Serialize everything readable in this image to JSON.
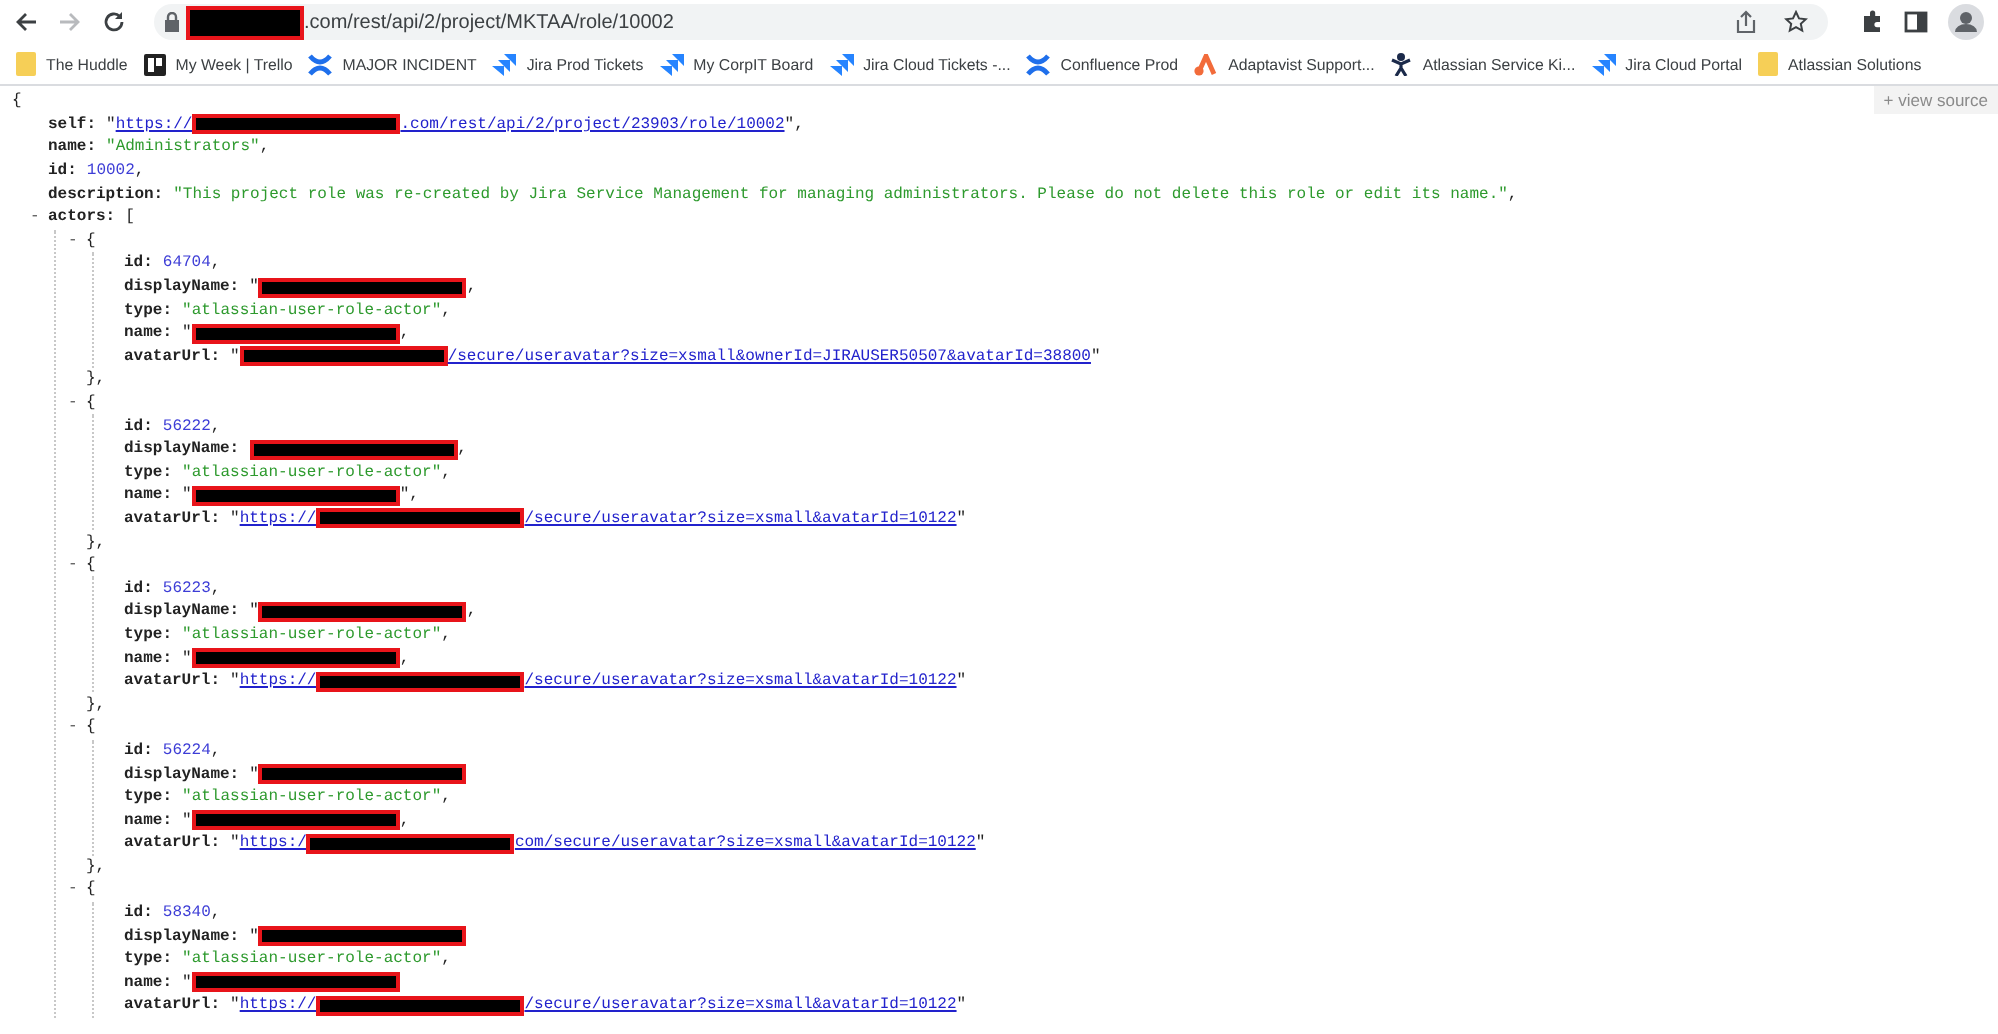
{
  "browser": {
    "back": {
      "disabled": false
    },
    "forward": {
      "disabled": true
    },
    "address": [
      {
        "kind": "redacted"
      },
      {
        "kind": "text",
        "text": ".com/rest/api/2/project/MKTAA/role/10002"
      }
    ],
    "bookmarks": [
      {
        "label": "The Huddle",
        "kind": "folder"
      },
      {
        "label": "My Week | Trello",
        "kind": "board"
      },
      {
        "label": "MAJOR INCIDENT",
        "kind": "cross"
      },
      {
        "label": "Jira Prod Tickets",
        "kind": "arrows"
      },
      {
        "label": "My CorpIT Board",
        "kind": "arrows"
      },
      {
        "label": "Jira Cloud Tickets -...",
        "kind": "arrows"
      },
      {
        "label": "Confluence Prod",
        "kind": "cross"
      },
      {
        "label": "Adaptavist Support...",
        "kind": "nodes"
      },
      {
        "label": "Atlassian Service Ki...",
        "kind": "figure"
      },
      {
        "label": "Jira Cloud Portal",
        "kind": "arrows"
      },
      {
        "label": "Atlassian Solutions",
        "kind": "folder"
      }
    ]
  },
  "view_source": "+ view source",
  "document": {
    "open": "{",
    "children": [
      {
        "key": "self:",
        "value": [
          {
            "kind": "punct",
            "text": "\""
          },
          {
            "kind": "link",
            "text": "https://"
          },
          {
            "kind": "redacted"
          },
          {
            "kind": "link",
            "text": ".com/rest/api/2/project/23903/role/10002"
          },
          {
            "kind": "punct",
            "text": "\","
          }
        ]
      },
      {
        "key": "name:",
        "value": [
          {
            "kind": "string",
            "text": "\"Administrators\""
          },
          {
            "kind": "punct",
            "text": ","
          }
        ]
      },
      {
        "key": "id:",
        "value": [
          {
            "kind": "number",
            "text": "10002"
          },
          {
            "kind": "punct",
            "text": ","
          }
        ]
      },
      {
        "key": "description:",
        "value": [
          {
            "kind": "string",
            "text": "\"This project role was re-created by Jira Service Management for managing administrators. Please do not delete this role or edit its name.\""
          },
          {
            "kind": "punct",
            "text": ","
          }
        ]
      },
      {
        "key": "actors:",
        "toggle": "-",
        "open": "[",
        "children": [
          {
            "toggle": "-",
            "open": "{",
            "close": "},",
            "children": [
              {
                "key": "id:",
                "value": [
                  {
                    "kind": "number",
                    "text": "64704"
                  },
                  {
                    "kind": "punct",
                    "text": ","
                  }
                ]
              },
              {
                "key": "displayName:",
                "value": [
                  {
                    "kind": "punct",
                    "text": "\""
                  },
                  {
                    "kind": "redacted"
                  },
                  {
                    "kind": "punct",
                    "text": ","
                  }
                ]
              },
              {
                "key": "type:",
                "value": [
                  {
                    "kind": "string",
                    "text": "\"atlassian-user-role-actor\""
                  },
                  {
                    "kind": "punct",
                    "text": ","
                  }
                ]
              },
              {
                "key": "name:",
                "value": [
                  {
                    "kind": "punct",
                    "text": "\""
                  },
                  {
                    "kind": "redacted"
                  },
                  {
                    "kind": "punct",
                    "text": ","
                  }
                ]
              },
              {
                "key": "avatarUrl:",
                "value": [
                  {
                    "kind": "punct",
                    "text": "\""
                  },
                  {
                    "kind": "redacted"
                  },
                  {
                    "kind": "link",
                    "text": "/secure/useravatar?size=xsmall&ownerId=JIRAUSER50507&avatarId=38800"
                  },
                  {
                    "kind": "punct",
                    "text": "\""
                  }
                ]
              }
            ]
          },
          {
            "toggle": "-",
            "open": "{",
            "close": "},",
            "children": [
              {
                "key": "id:",
                "value": [
                  {
                    "kind": "number",
                    "text": "56222"
                  },
                  {
                    "kind": "punct",
                    "text": ","
                  }
                ]
              },
              {
                "key": "displayName:",
                "value": [
                  {
                    "kind": "redacted"
                  },
                  {
                    "kind": "punct",
                    "text": ","
                  }
                ]
              },
              {
                "key": "type:",
                "value": [
                  {
                    "kind": "string",
                    "text": "\"atlassian-user-role-actor\""
                  },
                  {
                    "kind": "punct",
                    "text": ","
                  }
                ]
              },
              {
                "key": "name:",
                "value": [
                  {
                    "kind": "punct",
                    "text": "\""
                  },
                  {
                    "kind": "redacted"
                  },
                  {
                    "kind": "punct",
                    "text": "\","
                  }
                ]
              },
              {
                "key": "avatarUrl:",
                "value": [
                  {
                    "kind": "punct",
                    "text": "\""
                  },
                  {
                    "kind": "link",
                    "text": "https://"
                  },
                  {
                    "kind": "redacted"
                  },
                  {
                    "kind": "link",
                    "text": "/secure/useravatar?size=xsmall&avatarId=10122"
                  },
                  {
                    "kind": "punct",
                    "text": "\""
                  }
                ]
              }
            ]
          },
          {
            "toggle": "-",
            "open": "{",
            "close": "},",
            "children": [
              {
                "key": "id:",
                "value": [
                  {
                    "kind": "number",
                    "text": "56223"
                  },
                  {
                    "kind": "punct",
                    "text": ","
                  }
                ]
              },
              {
                "key": "displayName:",
                "value": [
                  {
                    "kind": "punct",
                    "text": "\""
                  },
                  {
                    "kind": "redacted"
                  },
                  {
                    "kind": "punct",
                    "text": ","
                  }
                ]
              },
              {
                "key": "type:",
                "value": [
                  {
                    "kind": "string",
                    "text": "\"atlassian-user-role-actor\""
                  },
                  {
                    "kind": "punct",
                    "text": ","
                  }
                ]
              },
              {
                "key": "name:",
                "value": [
                  {
                    "kind": "punct",
                    "text": "\""
                  },
                  {
                    "kind": "redacted"
                  },
                  {
                    "kind": "punct",
                    "text": ","
                  }
                ]
              },
              {
                "key": "avatarUrl:",
                "value": [
                  {
                    "kind": "punct",
                    "text": "\""
                  },
                  {
                    "kind": "link",
                    "text": "https://"
                  },
                  {
                    "kind": "redacted"
                  },
                  {
                    "kind": "link",
                    "text": "/secure/useravatar?size=xsmall&avatarId=10122"
                  },
                  {
                    "kind": "punct",
                    "text": "\""
                  }
                ]
              }
            ]
          },
          {
            "toggle": "-",
            "open": "{",
            "close": "},",
            "children": [
              {
                "key": "id:",
                "value": [
                  {
                    "kind": "number",
                    "text": "56224"
                  },
                  {
                    "kind": "punct",
                    "text": ","
                  }
                ]
              },
              {
                "key": "displayName:",
                "value": [
                  {
                    "kind": "punct",
                    "text": "\""
                  },
                  {
                    "kind": "redacted"
                  }
                ]
              },
              {
                "key": "type:",
                "value": [
                  {
                    "kind": "string",
                    "text": "\"atlassian-user-role-actor\""
                  },
                  {
                    "kind": "punct",
                    "text": ","
                  }
                ]
              },
              {
                "key": "name:",
                "value": [
                  {
                    "kind": "punct",
                    "text": "\""
                  },
                  {
                    "kind": "redacted"
                  },
                  {
                    "kind": "punct",
                    "text": ","
                  }
                ]
              },
              {
                "key": "avatarUrl:",
                "value": [
                  {
                    "kind": "punct",
                    "text": "\""
                  },
                  {
                    "kind": "link",
                    "text": "https:/"
                  },
                  {
                    "kind": "redacted"
                  },
                  {
                    "kind": "link",
                    "text": "com/secure/useravatar?size=xsmall&avatarId=10122"
                  },
                  {
                    "kind": "punct",
                    "text": "\""
                  }
                ]
              }
            ]
          },
          {
            "toggle": "-",
            "open": "{",
            "children": [
              {
                "key": "id:",
                "value": [
                  {
                    "kind": "number",
                    "text": "58340"
                  },
                  {
                    "kind": "punct",
                    "text": ","
                  }
                ]
              },
              {
                "key": "displayName:",
                "value": [
                  {
                    "kind": "punct",
                    "text": "\""
                  },
                  {
                    "kind": "redacted"
                  }
                ]
              },
              {
                "key": "type:",
                "value": [
                  {
                    "kind": "string",
                    "text": "\"atlassian-user-role-actor\""
                  },
                  {
                    "kind": "punct",
                    "text": ","
                  }
                ]
              },
              {
                "key": "name:",
                "value": [
                  {
                    "kind": "punct",
                    "text": "\""
                  },
                  {
                    "kind": "redacted"
                  }
                ]
              },
              {
                "key": "avatarUrl:",
                "value": [
                  {
                    "kind": "punct",
                    "text": "\""
                  },
                  {
                    "kind": "link",
                    "text": "https://"
                  },
                  {
                    "kind": "redacted"
                  },
                  {
                    "kind": "link",
                    "text": "/secure/useravatar?size=xsmall&avatarId=10122"
                  },
                  {
                    "kind": "punct",
                    "text": "\""
                  }
                ]
              }
            ]
          }
        ]
      }
    ]
  }
}
